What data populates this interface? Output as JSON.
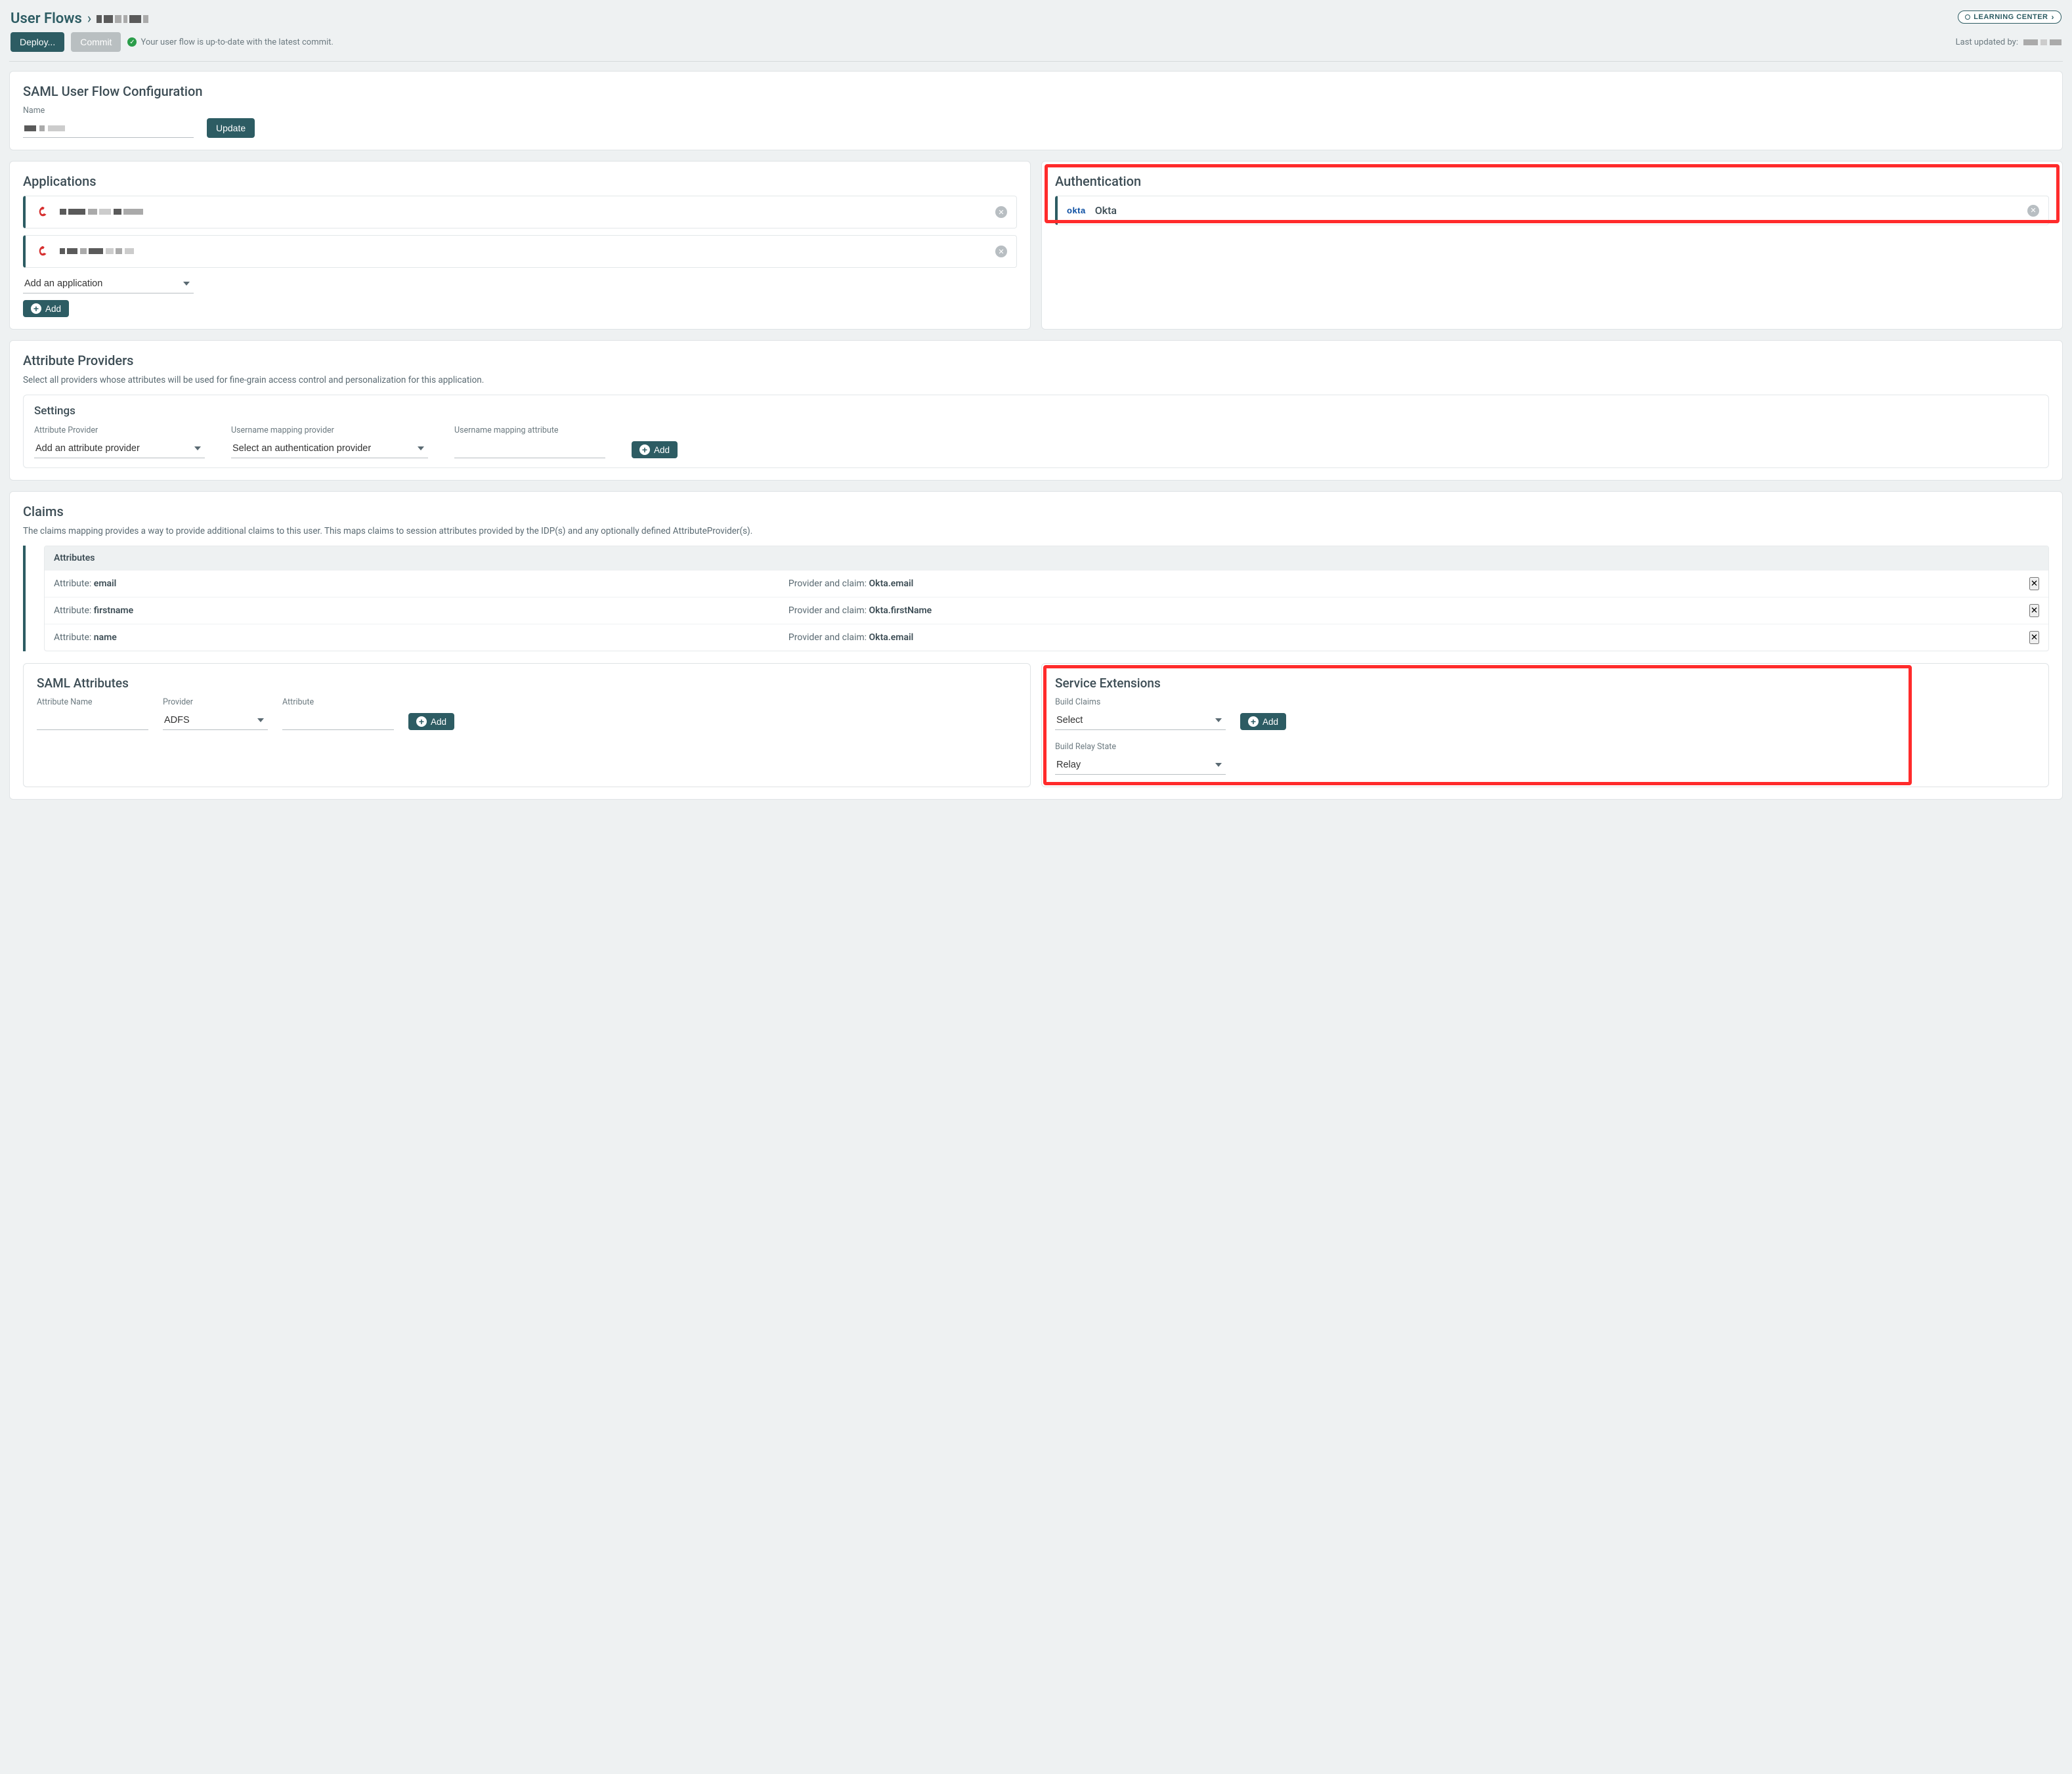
{
  "breadcrumb": {
    "root": "User Flows"
  },
  "header": {
    "deploy": "Deploy...",
    "commit": "Commit",
    "status": "Your user flow is up-to-date with the latest commit.",
    "learning_center": "LEARNING CENTER",
    "last_updated_label": "Last updated by:"
  },
  "saml_config": {
    "title": "SAML User Flow Configuration",
    "name_label": "Name",
    "update": "Update"
  },
  "applications": {
    "title": "Applications",
    "add_placeholder": "Add an application",
    "add_btn": "Add"
  },
  "authentication": {
    "title": "Authentication",
    "item_label": "Okta",
    "logo_text": "okta"
  },
  "attribute_providers": {
    "title": "Attribute Providers",
    "desc": "Select all providers whose attributes will be used for fine-grain access control and personalization for this application.",
    "settings_title": "Settings",
    "attr_provider_label": "Attribute Provider",
    "attr_provider_placeholder": "Add an attribute provider",
    "uname_provider_label": "Username mapping provider",
    "uname_provider_placeholder": "Select an authentication provider",
    "uname_attr_label": "Username mapping attribute",
    "add_btn": "Add"
  },
  "claims": {
    "title": "Claims",
    "desc": "The claims mapping provides a way to provide additional claims to this user. This maps claims to session attributes provided by the IDP(s) and any optionally defined AttributeProvider(s).",
    "table_header": "Attributes",
    "attribute_label": "Attribute:",
    "provider_label": "Provider and claim:",
    "rows": [
      {
        "attr": "email",
        "provider": "Okta.email"
      },
      {
        "attr": "firstname",
        "provider": "Okta.firstName"
      },
      {
        "attr": "name",
        "provider": "Okta.email"
      }
    ]
  },
  "saml_attributes": {
    "title": "SAML Attributes",
    "attr_name_label": "Attribute Name",
    "provider_label": "Provider",
    "provider_value": "ADFS",
    "attribute_label": "Attribute",
    "add_btn": "Add"
  },
  "service_extensions": {
    "title": "Service Extensions",
    "build_claims_label": "Build Claims",
    "build_claims_value": "Select",
    "add_btn": "Add",
    "build_relay_label": "Build Relay State",
    "build_relay_value": "Relay"
  }
}
